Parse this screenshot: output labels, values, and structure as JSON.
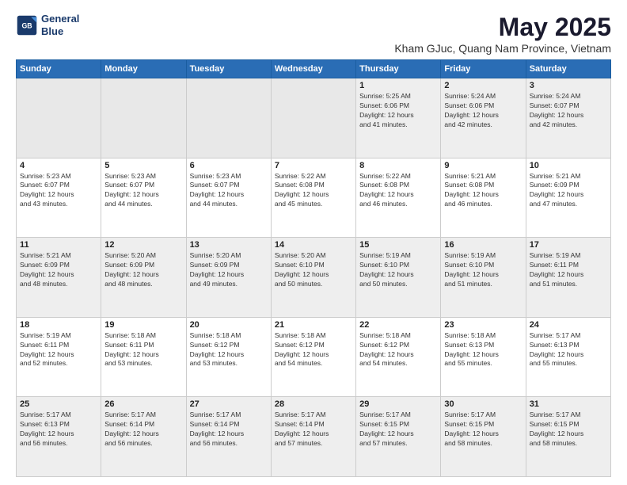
{
  "header": {
    "logo_line1": "General",
    "logo_line2": "Blue",
    "month": "May 2025",
    "location": "Kham GJuc, Quang Nam Province, Vietnam"
  },
  "weekdays": [
    "Sunday",
    "Monday",
    "Tuesday",
    "Wednesday",
    "Thursday",
    "Friday",
    "Saturday"
  ],
  "weeks": [
    [
      {
        "day": "",
        "info": ""
      },
      {
        "day": "",
        "info": ""
      },
      {
        "day": "",
        "info": ""
      },
      {
        "day": "",
        "info": ""
      },
      {
        "day": "1",
        "info": "Sunrise: 5:25 AM\nSunset: 6:06 PM\nDaylight: 12 hours\nand 41 minutes."
      },
      {
        "day": "2",
        "info": "Sunrise: 5:24 AM\nSunset: 6:06 PM\nDaylight: 12 hours\nand 42 minutes."
      },
      {
        "day": "3",
        "info": "Sunrise: 5:24 AM\nSunset: 6:07 PM\nDaylight: 12 hours\nand 42 minutes."
      }
    ],
    [
      {
        "day": "4",
        "info": "Sunrise: 5:23 AM\nSunset: 6:07 PM\nDaylight: 12 hours\nand 43 minutes."
      },
      {
        "day": "5",
        "info": "Sunrise: 5:23 AM\nSunset: 6:07 PM\nDaylight: 12 hours\nand 44 minutes."
      },
      {
        "day": "6",
        "info": "Sunrise: 5:23 AM\nSunset: 6:07 PM\nDaylight: 12 hours\nand 44 minutes."
      },
      {
        "day": "7",
        "info": "Sunrise: 5:22 AM\nSunset: 6:08 PM\nDaylight: 12 hours\nand 45 minutes."
      },
      {
        "day": "8",
        "info": "Sunrise: 5:22 AM\nSunset: 6:08 PM\nDaylight: 12 hours\nand 46 minutes."
      },
      {
        "day": "9",
        "info": "Sunrise: 5:21 AM\nSunset: 6:08 PM\nDaylight: 12 hours\nand 46 minutes."
      },
      {
        "day": "10",
        "info": "Sunrise: 5:21 AM\nSunset: 6:09 PM\nDaylight: 12 hours\nand 47 minutes."
      }
    ],
    [
      {
        "day": "11",
        "info": "Sunrise: 5:21 AM\nSunset: 6:09 PM\nDaylight: 12 hours\nand 48 minutes."
      },
      {
        "day": "12",
        "info": "Sunrise: 5:20 AM\nSunset: 6:09 PM\nDaylight: 12 hours\nand 48 minutes."
      },
      {
        "day": "13",
        "info": "Sunrise: 5:20 AM\nSunset: 6:09 PM\nDaylight: 12 hours\nand 49 minutes."
      },
      {
        "day": "14",
        "info": "Sunrise: 5:20 AM\nSunset: 6:10 PM\nDaylight: 12 hours\nand 50 minutes."
      },
      {
        "day": "15",
        "info": "Sunrise: 5:19 AM\nSunset: 6:10 PM\nDaylight: 12 hours\nand 50 minutes."
      },
      {
        "day": "16",
        "info": "Sunrise: 5:19 AM\nSunset: 6:10 PM\nDaylight: 12 hours\nand 51 minutes."
      },
      {
        "day": "17",
        "info": "Sunrise: 5:19 AM\nSunset: 6:11 PM\nDaylight: 12 hours\nand 51 minutes."
      }
    ],
    [
      {
        "day": "18",
        "info": "Sunrise: 5:19 AM\nSunset: 6:11 PM\nDaylight: 12 hours\nand 52 minutes."
      },
      {
        "day": "19",
        "info": "Sunrise: 5:18 AM\nSunset: 6:11 PM\nDaylight: 12 hours\nand 53 minutes."
      },
      {
        "day": "20",
        "info": "Sunrise: 5:18 AM\nSunset: 6:12 PM\nDaylight: 12 hours\nand 53 minutes."
      },
      {
        "day": "21",
        "info": "Sunrise: 5:18 AM\nSunset: 6:12 PM\nDaylight: 12 hours\nand 54 minutes."
      },
      {
        "day": "22",
        "info": "Sunrise: 5:18 AM\nSunset: 6:12 PM\nDaylight: 12 hours\nand 54 minutes."
      },
      {
        "day": "23",
        "info": "Sunrise: 5:18 AM\nSunset: 6:13 PM\nDaylight: 12 hours\nand 55 minutes."
      },
      {
        "day": "24",
        "info": "Sunrise: 5:17 AM\nSunset: 6:13 PM\nDaylight: 12 hours\nand 55 minutes."
      }
    ],
    [
      {
        "day": "25",
        "info": "Sunrise: 5:17 AM\nSunset: 6:13 PM\nDaylight: 12 hours\nand 56 minutes."
      },
      {
        "day": "26",
        "info": "Sunrise: 5:17 AM\nSunset: 6:14 PM\nDaylight: 12 hours\nand 56 minutes."
      },
      {
        "day": "27",
        "info": "Sunrise: 5:17 AM\nSunset: 6:14 PM\nDaylight: 12 hours\nand 56 minutes."
      },
      {
        "day": "28",
        "info": "Sunrise: 5:17 AM\nSunset: 6:14 PM\nDaylight: 12 hours\nand 57 minutes."
      },
      {
        "day": "29",
        "info": "Sunrise: 5:17 AM\nSunset: 6:15 PM\nDaylight: 12 hours\nand 57 minutes."
      },
      {
        "day": "30",
        "info": "Sunrise: 5:17 AM\nSunset: 6:15 PM\nDaylight: 12 hours\nand 58 minutes."
      },
      {
        "day": "31",
        "info": "Sunrise: 5:17 AM\nSunset: 6:15 PM\nDaylight: 12 hours\nand 58 minutes."
      }
    ]
  ]
}
